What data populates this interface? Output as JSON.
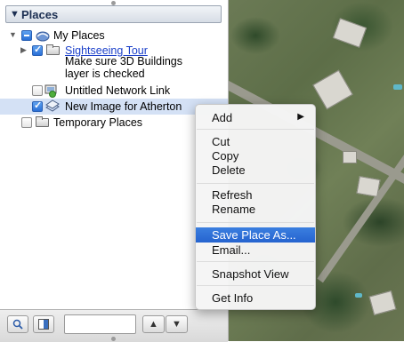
{
  "places_panel": {
    "title": "Places",
    "items": [
      {
        "label": "My Places"
      },
      {
        "label": "Sightseeing Tour",
        "note_line1": "Make sure 3D Buildings",
        "note_line2": "layer is checked"
      },
      {
        "label": "Untitled Network Link"
      },
      {
        "label": "New Image for Atherton"
      },
      {
        "label": "Temporary Places"
      }
    ]
  },
  "context_menu": {
    "items": [
      "Add",
      "Cut",
      "Copy",
      "Delete",
      "Refresh",
      "Rename",
      "Save Place As...",
      "Email...",
      "Snapshot View",
      "Get Info"
    ],
    "highlighted": "Save Place As...",
    "highlight_color": "#2f6fd8"
  },
  "toolbar": {
    "search_value": "",
    "icons": [
      "search-icon",
      "sidebar-toggle-icon",
      "move-up-icon",
      "move-down-icon"
    ]
  }
}
